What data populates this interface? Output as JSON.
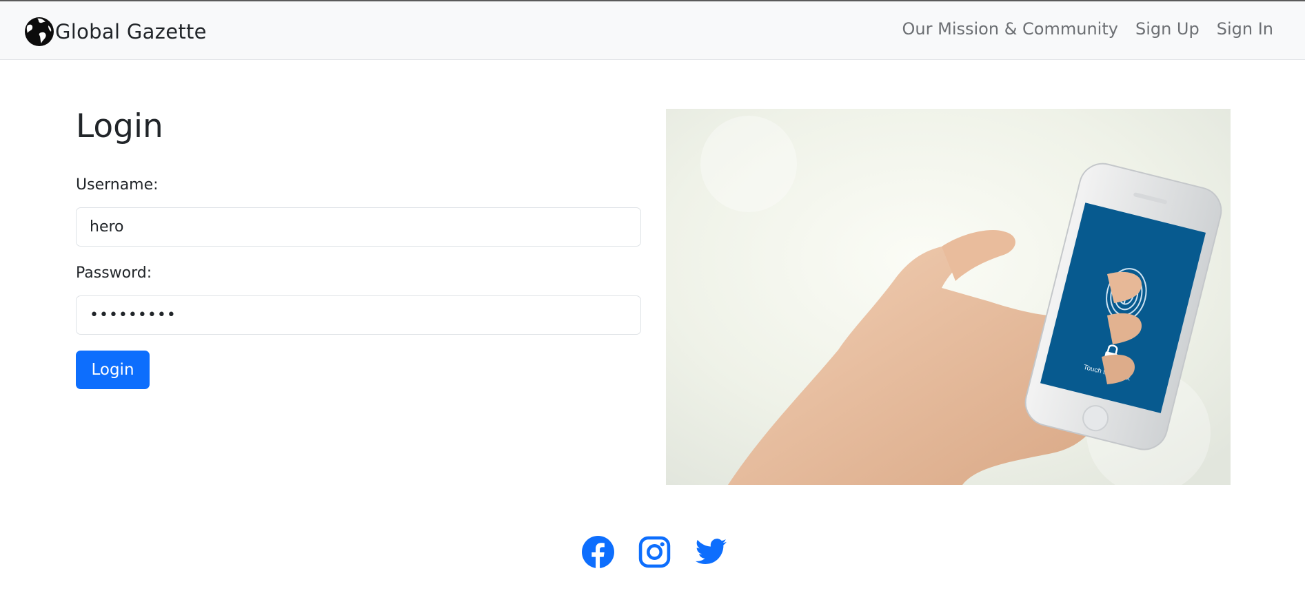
{
  "brand": {
    "name": "Global Gazette",
    "icon": "globe-icon"
  },
  "nav": {
    "links": [
      {
        "label": "Our Mission & Community"
      },
      {
        "label": "Sign Up"
      },
      {
        "label": "Sign In"
      }
    ]
  },
  "login": {
    "title": "Login",
    "username_label": "Username:",
    "username_value": "hero",
    "password_label": "Password:",
    "password_value": "heroheroo",
    "submit_label": "Login"
  },
  "hero_image": {
    "caption": "Touch to unlock",
    "icon": "fingerprint-icon"
  },
  "socials": [
    {
      "name": "facebook-icon"
    },
    {
      "name": "instagram-icon"
    },
    {
      "name": "twitter-icon"
    }
  ],
  "colors": {
    "accent": "#0d6efd",
    "navbar_bg": "#f8f9fa",
    "nav_link": "#6c6f73",
    "phone_screen": "#075a8f"
  }
}
